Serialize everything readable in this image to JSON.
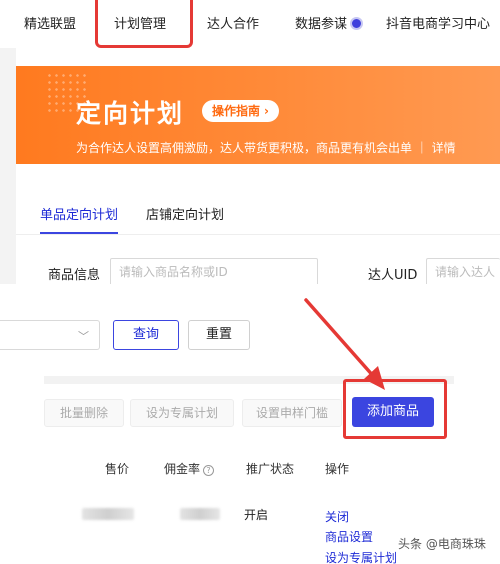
{
  "nav": {
    "items": [
      "精选联盟",
      "计划管理",
      "达人合作",
      "数据参谋",
      "抖音电商学习中心"
    ]
  },
  "banner": {
    "title": "定向计划",
    "guide_button": "操作指南",
    "subtitle": "为合作达人设置高佣激励，达人带货更积极，商品更有机会出单 ｜ 详情"
  },
  "tabs": [
    {
      "label": "单品定向计划",
      "active": true
    },
    {
      "label": "店铺定向计划",
      "active": false
    }
  ],
  "filters": {
    "product_label": "商品信息",
    "product_placeholder": "请输入商品名称或ID",
    "creator_label": "达人UID",
    "creator_placeholder": "请输入达人"
  },
  "actions": {
    "query": "查询",
    "reset": "重置",
    "batch_delete": "批量删除",
    "set_exclusive": "设为专属计划",
    "sample_threshold": "设置申样门槛",
    "add_product": "添加商品"
  },
  "table": {
    "columns": [
      "售价",
      "佣金率",
      "推广状态",
      "操作"
    ],
    "rows": [
      {
        "status": "开启",
        "operations": [
          "关闭",
          "商品设置",
          "设为专属计划"
        ]
      }
    ]
  },
  "watermark": "头条 @电商珠珠",
  "colors": {
    "accent": "#3b45e0",
    "banner": "#ff7a1f",
    "highlight": "#e53935"
  }
}
